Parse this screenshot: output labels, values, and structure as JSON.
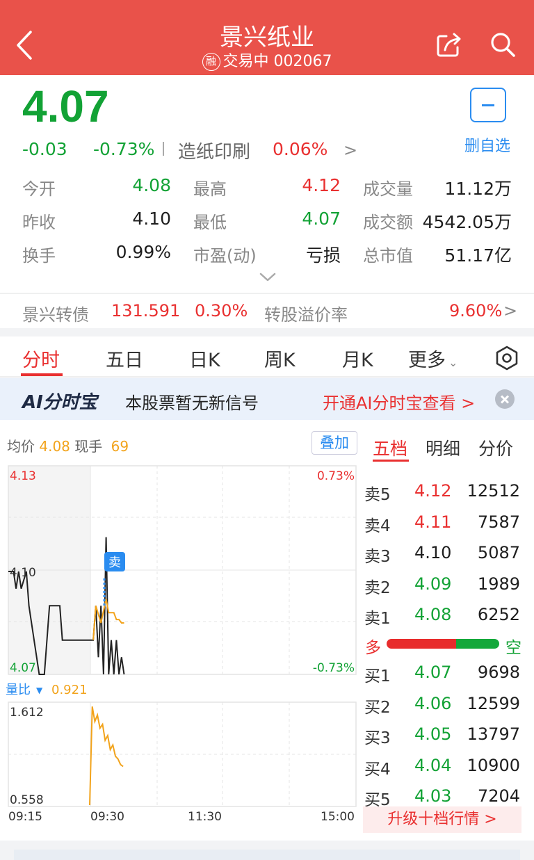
{
  "header": {
    "title": "景兴纸业",
    "margin_badge": "融",
    "status": "交易中",
    "code": "002067"
  },
  "quote": {
    "price": "4.07",
    "change": "-0.03",
    "change_pct": "-0.73%",
    "industry": "造纸印刷",
    "industry_pct": "0.06%",
    "fav_label": "删自选"
  },
  "stats": [
    {
      "label": "今开",
      "value": "4.08",
      "color": "#12a235"
    },
    {
      "label": "最高",
      "value": "4.12",
      "color": "#e93030"
    },
    {
      "label": "成交量",
      "value": "11.12万",
      "color": "#1e1e1e"
    },
    {
      "label": "昨收",
      "value": "4.10",
      "color": "#1e1e1e"
    },
    {
      "label": "最低",
      "value": "4.07",
      "color": "#12a235"
    },
    {
      "label": "成交额",
      "value": "4542.05万",
      "color": "#1e1e1e"
    },
    {
      "label": "换手",
      "value": "0.99%",
      "color": "#1e1e1e"
    },
    {
      "label": "市盈(动)",
      "value": "亏损",
      "color": "#1e1e1e"
    },
    {
      "label": "总市值",
      "value": "51.17亿",
      "color": "#1e1e1e"
    }
  ],
  "bond": {
    "name": "景兴转债",
    "price": "131.591",
    "pct": "0.30%",
    "premium_label": "转股溢价率",
    "premium": "9.60%"
  },
  "tabs": [
    "分时",
    "五日",
    "日K",
    "周K",
    "月K",
    "更多"
  ],
  "ai_banner": {
    "logo": "AI分时宝",
    "message": "本股票暂无新信号",
    "link": "开通AI分时宝查看 >"
  },
  "chart_header": {
    "avg_label": "均价",
    "avg_value": "4.08",
    "last_label": "现手",
    "last_value": "69",
    "overlay_button": "叠加"
  },
  "chart_data": [
    {
      "type": "line",
      "title": "",
      "y_tick_labels": [
        "4.13",
        "4.10",
        "4.07"
      ],
      "right_tick_labels": [
        "0.73%",
        "-0.73%"
      ],
      "ylim": [
        4.07,
        4.13
      ],
      "series": [
        {
          "name": "价格",
          "color": "#222222",
          "points": [
            [
              0,
              4.1
            ],
            [
              2,
              4.1
            ],
            [
              3,
              4.095
            ],
            [
              4,
              4.1
            ],
            [
              5,
              4.095
            ],
            [
              7,
              4.1
            ],
            [
              8,
              4.09
            ],
            [
              12,
              4.07
            ],
            [
              14,
              4.07
            ],
            [
              16,
              4.09
            ],
            [
              20,
              4.09
            ],
            [
              21,
              4.08
            ],
            [
              24,
              4.08
            ],
            [
              33,
              4.08
            ],
            [
              34,
              4.09
            ],
            [
              35,
              4.075
            ],
            [
              36,
              4.09
            ],
            [
              37,
              4.07
            ],
            [
              38,
              4.11
            ],
            [
              39,
              4.07
            ],
            [
              40,
              4.08
            ],
            [
              41,
              4.07
            ],
            [
              42,
              4.08
            ],
            [
              43,
              4.07
            ],
            [
              44,
              4.075
            ],
            [
              45,
              4.07
            ]
          ]
        },
        {
          "name": "均价",
          "color": "#f2a31b",
          "points": [
            [
              33,
              4.08
            ],
            [
              34,
              4.09
            ],
            [
              36,
              4.085
            ],
            [
              38,
              4.092
            ],
            [
              39,
              4.088
            ],
            [
              41,
              4.088
            ],
            [
              42,
              4.086
            ],
            [
              43,
              4.086
            ],
            [
              44,
              4.085
            ],
            [
              45,
              4.085
            ]
          ]
        }
      ],
      "annotation": "卖",
      "grid": true
    },
    {
      "type": "line",
      "title": "量比",
      "current_value": "0.921",
      "y_tick_labels": [
        "1.612",
        "0.558"
      ],
      "ylim": [
        0.558,
        1.612
      ],
      "x_tick_labels": [
        "09:15",
        "09:30",
        "11:30",
        "15:00"
      ],
      "series": [
        {
          "name": "量比",
          "color": "#f2a31b",
          "points": [
            [
              0,
              0.558
            ],
            [
              1,
              1.61
            ],
            [
              2,
              1.45
            ],
            [
              3,
              1.52
            ],
            [
              4,
              1.38
            ],
            [
              5,
              1.42
            ],
            [
              6,
              1.25
            ],
            [
              7,
              1.3
            ],
            [
              8,
              1.15
            ],
            [
              9,
              1.2
            ],
            [
              10,
              1.08
            ],
            [
              11,
              1.05
            ],
            [
              12,
              0.99
            ],
            [
              13,
              0.97
            ]
          ]
        }
      ],
      "grid": true
    }
  ],
  "order_book": {
    "tabs": [
      "五档",
      "明细",
      "分价"
    ],
    "asks": [
      {
        "label": "卖5",
        "price": "4.12",
        "vol": "12512",
        "color": "#e93030"
      },
      {
        "label": "卖4",
        "price": "4.11",
        "vol": "7587",
        "color": "#e93030"
      },
      {
        "label": "卖3",
        "price": "4.10",
        "vol": "5087",
        "color": "#1e1e1e"
      },
      {
        "label": "卖2",
        "price": "4.09",
        "vol": "1989",
        "color": "#12a235"
      },
      {
        "label": "卖1",
        "price": "4.08",
        "vol": "6252",
        "color": "#12a235"
      }
    ],
    "bull_label": "多",
    "bear_label": "空",
    "bull_ratio": 0.62,
    "bids": [
      {
        "label": "买1",
        "price": "4.07",
        "vol": "9698",
        "color": "#12a235"
      },
      {
        "label": "买2",
        "price": "4.06",
        "vol": "12599",
        "color": "#12a235"
      },
      {
        "label": "买3",
        "price": "4.05",
        "vol": "13797",
        "color": "#12a235"
      },
      {
        "label": "买4",
        "price": "4.04",
        "vol": "10900",
        "color": "#12a235"
      },
      {
        "label": "买5",
        "price": "4.03",
        "vol": "7204",
        "color": "#12a235"
      }
    ],
    "upgrade_label": "升级十档行情 >"
  }
}
